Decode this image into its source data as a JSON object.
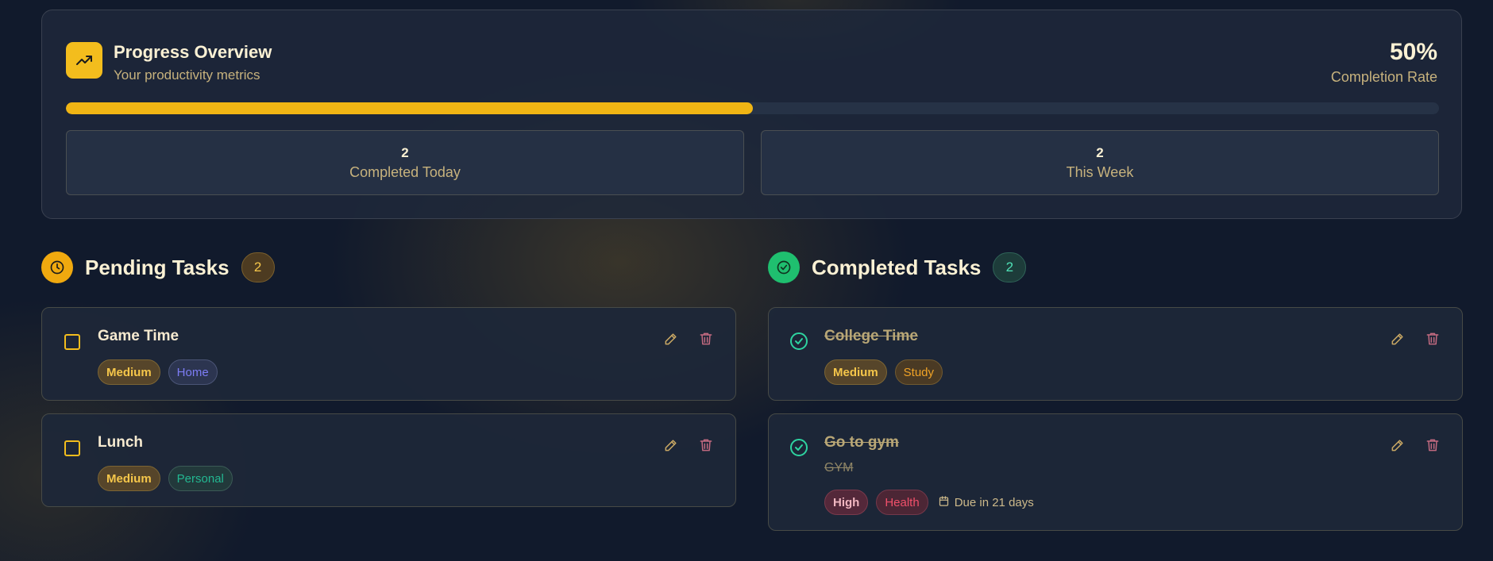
{
  "overview": {
    "title": "Progress Overview",
    "subtitle": "Your productivity metrics",
    "completion_value": "50%",
    "completion_label": "Completion Rate",
    "progress_fraction": 0.5,
    "icon": "trending-up-icon",
    "stats": [
      {
        "value": "2",
        "label": "Completed Today"
      },
      {
        "value": "2",
        "label": "This Week"
      }
    ]
  },
  "pending": {
    "title": "Pending Tasks",
    "count": "2",
    "icon": "clock-icon",
    "tasks": [
      {
        "title": "Game Time",
        "priority": "Medium",
        "category": "Home"
      },
      {
        "title": "Lunch",
        "priority": "Medium",
        "category": "Personal"
      }
    ]
  },
  "completed": {
    "title": "Completed Tasks",
    "count": "2",
    "icon": "check-circle-icon",
    "tasks": [
      {
        "title": "College Time",
        "priority": "Medium",
        "category": "Study"
      },
      {
        "title": "Go to gym",
        "description": "GYM",
        "priority": "High",
        "category": "Health",
        "due": "Due in 21 days"
      }
    ]
  },
  "colors": {
    "accent": "#f3bd1d",
    "success": "#22c37a",
    "background": "#111a2c"
  }
}
